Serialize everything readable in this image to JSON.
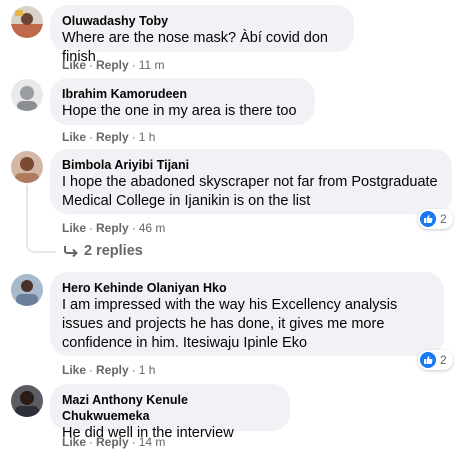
{
  "actions": {
    "like_label": "Like",
    "reply_label": "Reply",
    "separator": "·"
  },
  "comments": [
    {
      "author": "Oluwadashy Toby",
      "text": "Where are the nose mask? Àbí covid don finish",
      "time": "11 m",
      "avatar_color": "#c0694a"
    },
    {
      "author": "Ibrahim Kamorudeen",
      "text": "Hope the one in my area is there too",
      "time": "1 h",
      "avatar_color": "#8a8d91"
    },
    {
      "author": "Bimbola Ariyibi Tijani",
      "text": "I hope the abadoned skyscraper not far from Postgraduate Medical College in Ijanikin is on the list",
      "time": "46 m",
      "reactions": "2",
      "avatar_color": "#b07a60"
    },
    {
      "author": "Hero Kehinde Olaniyan Hko",
      "text": "I am impressed with the way his Excellency analysis issues and projects he has done, it gives me more confidence in him. Itesiwaju Ipinle Eko",
      "time": "1 h",
      "reactions": "2",
      "avatar_color": "#6a7f9a"
    },
    {
      "author": "Mazi Anthony Kenule Chukwuemeka",
      "text": "He did well in the interview",
      "time": "14 m",
      "avatar_color": "#2d3036"
    }
  ],
  "replies_label": "2 replies",
  "colors": {
    "bubble": "#f0f2f5",
    "meta": "#65676b",
    "like_blue": "#1877f2"
  }
}
